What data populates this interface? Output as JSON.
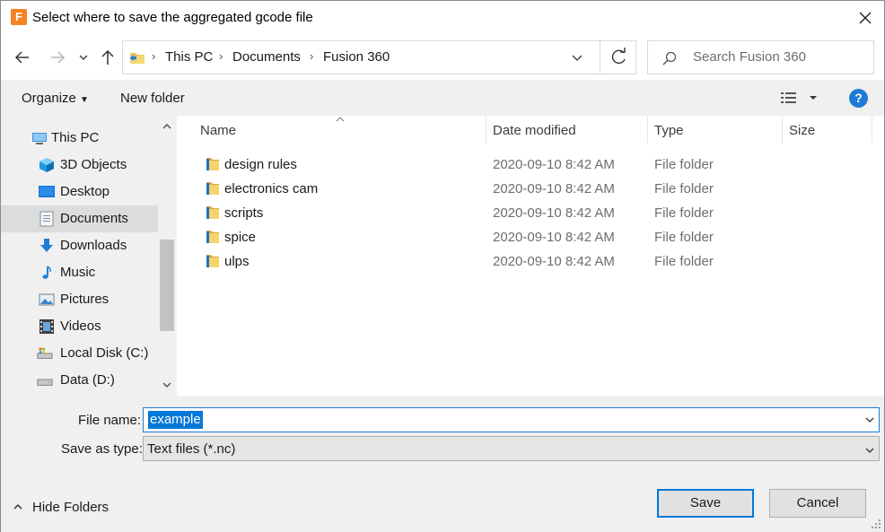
{
  "window": {
    "title": "Select where to save the aggregated gcode file",
    "app_icon_letter": "F"
  },
  "address": {
    "crumbs": [
      "This PC",
      "Documents",
      "Fusion 360"
    ]
  },
  "search": {
    "placeholder": "Search Fusion 360"
  },
  "commands": {
    "organize": "Organize",
    "new_folder": "New folder",
    "help": "?"
  },
  "nav_pane": {
    "items": [
      {
        "label": "This PC",
        "icon": "computer-icon"
      },
      {
        "label": "3D Objects",
        "icon": "3d-objects-icon"
      },
      {
        "label": "Desktop",
        "icon": "desktop-icon"
      },
      {
        "label": "Documents",
        "icon": "documents-icon",
        "selected": true
      },
      {
        "label": "Downloads",
        "icon": "downloads-icon"
      },
      {
        "label": "Music",
        "icon": "music-icon"
      },
      {
        "label": "Pictures",
        "icon": "pictures-icon"
      },
      {
        "label": "Videos",
        "icon": "videos-icon"
      },
      {
        "label": "Local Disk (C:)",
        "icon": "local-disk-icon"
      },
      {
        "label": "Data (D:)",
        "icon": "drive-icon"
      }
    ]
  },
  "file_list": {
    "columns": [
      "Name",
      "Date modified",
      "Type",
      "Size"
    ],
    "rows": [
      {
        "name": "design rules",
        "date": "2020-09-10 8:42 AM",
        "type": "File folder"
      },
      {
        "name": "electronics cam",
        "date": "2020-09-10 8:42 AM",
        "type": "File folder"
      },
      {
        "name": "scripts",
        "date": "2020-09-10 8:42 AM",
        "type": "File folder"
      },
      {
        "name": "spice",
        "date": "2020-09-10 8:42 AM",
        "type": "File folder"
      },
      {
        "name": "ulps",
        "date": "2020-09-10 8:42 AM",
        "type": "File folder"
      }
    ]
  },
  "save_panel": {
    "file_name_label": "File name:",
    "file_name_value": "example",
    "save_as_type_label": "Save as type:",
    "save_as_type_value": "Text files (*.nc)",
    "hide_folders": "Hide Folders",
    "save": "Save",
    "cancel": "Cancel"
  },
  "colors": {
    "accent": "#0078d7",
    "folder": "#f2c55c",
    "help": "#1e7bd3"
  }
}
